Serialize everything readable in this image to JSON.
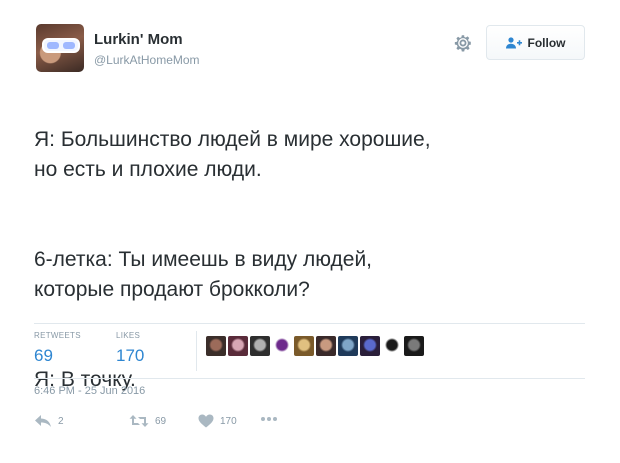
{
  "user": {
    "name": "Lurkin' Mom",
    "handle": "@LurkAtHomeMom"
  },
  "follow_button": {
    "label": "Follow"
  },
  "tweet_text": [
    "Я: Большинство людей в мире хорошие,\nно есть и плохие люди.",
    "6-летка: Ты имеешь в виду людей,\nкоторые продают брокколи?",
    "Я: В точку."
  ],
  "stats": {
    "retweets_label": "RETWEETS",
    "retweets_count": "69",
    "likes_label": "LIKES",
    "likes_count": "170"
  },
  "liker_avatars": [
    {
      "colors": [
        "#3b2e2a",
        "#9c6b5a"
      ]
    },
    {
      "colors": [
        "#5a2b3a",
        "#d8a7b5"
      ]
    },
    {
      "colors": [
        "#2e2e2e",
        "#b0b0b0"
      ]
    },
    {
      "colors": [
        "#ffffff",
        "#6d2a8c"
      ]
    },
    {
      "colors": [
        "#7a5a2a",
        "#e0c080"
      ]
    },
    {
      "colors": [
        "#3a2a2a",
        "#c89a80"
      ]
    },
    {
      "colors": [
        "#1f3a5a",
        "#7fa6c8"
      ]
    },
    {
      "colors": [
        "#2a1f3a",
        "#5a6acc"
      ]
    },
    {
      "colors": [
        "#ffffff",
        "#1a1a1a"
      ]
    },
    {
      "colors": [
        "#1a1a1a",
        "#7a7a7a"
      ]
    }
  ],
  "timestamp": "6:46 PM - 25 Jun 2016",
  "actions": {
    "reply_count": "2",
    "retweet_count": "69",
    "like_count": "170"
  },
  "colors": {
    "link_blue": "#2e86d1",
    "muted": "#8899a6",
    "text": "#292f33",
    "divider": "#e1e8ed"
  }
}
